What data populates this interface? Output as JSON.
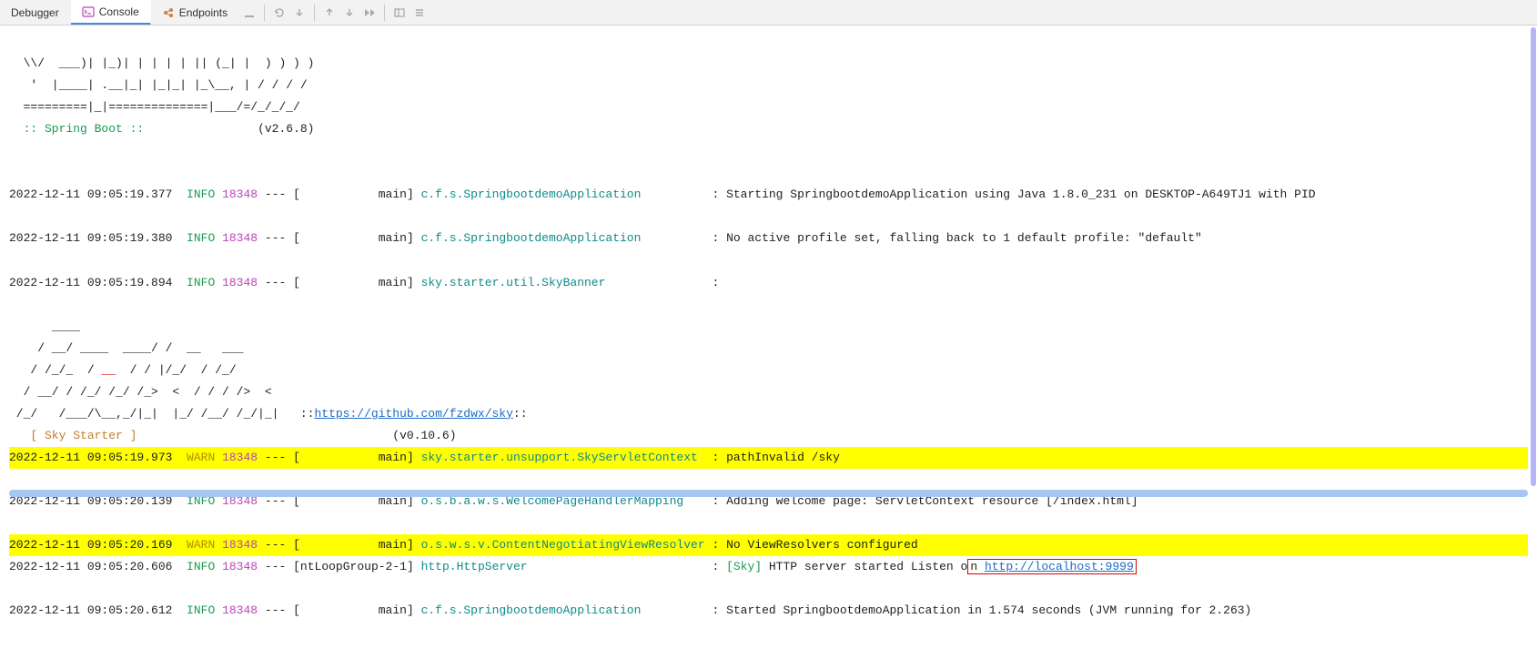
{
  "tabs": {
    "debugger": "Debugger",
    "console": "Console",
    "endpoints": "Endpoints"
  },
  "banner": {
    "line1": "  \\\\/  ___)| |_)| | | | | || (_| |  ) ) ) )",
    "line2": "   '  |____| .__|_| |_|_| |_\\__, | / / / /",
    "line3": "  =========|_|==============|___/=/_/_/_/",
    "label": "  :: Spring Boot ::",
    "version": "(v2.6.8)"
  },
  "logs": [
    {
      "ts": "2022-12-11 09:05:19.377",
      "level": "INFO",
      "pid": "18348",
      "thread": "[           main]",
      "logger": "c.f.s.SpringbootdemoApplication         ",
      "msg": "Starting SpringbootdemoApplication using Java 1.8.0_231 on DESKTOP-A649TJ1 with PID"
    },
    {
      "ts": "2022-12-11 09:05:19.380",
      "level": "INFO",
      "pid": "18348",
      "thread": "[           main]",
      "logger": "c.f.s.SpringbootdemoApplication         ",
      "msg": "No active profile set, falling back to 1 default profile: \"default\""
    },
    {
      "ts": "2022-12-11 09:05:19.894",
      "level": "INFO",
      "pid": "18348",
      "thread": "[           main]",
      "logger": "sky.starter.util.SkyBanner              ",
      "msg": ""
    }
  ],
  "skyBanner": {
    "l1": "      ____",
    "l2": "    / __/ ____  ____/ /  __   ___",
    "l3": "   / /_/_  / __  / / |/_/  / /_/",
    "l4": "  / __/ / /_/ /_/ /_>  <  / / / />  <",
    "l5": " /_/   /___/\\__,_/|_|  |_/ /__/ /_/|_|   ::",
    "link": "https://github.com/fzdwx/sky",
    "linkSuffix": "::",
    "label": "   [ Sky Starter ]",
    "version": "(v0.10.6)"
  },
  "logs2": [
    {
      "ts": "2022-12-11 09:05:19.973",
      "level": "WARN",
      "pid": "18348",
      "thread": "[           main]",
      "logger": "sky.starter.unsupport.SkyServletContext ",
      "msg": "pathInvalid /sky",
      "warn": true
    },
    {
      "ts": "2022-12-11 09:05:20.139",
      "level": "INFO",
      "pid": "18348",
      "thread": "[           main]",
      "logger": "o.s.b.a.w.s.WelcomePageHandlerMapping   ",
      "msg": "Adding welcome page: ServletContext resource [/index.html]"
    },
    {
      "ts": "2022-12-11 09:05:20.169",
      "level": "WARN",
      "pid": "18348",
      "thread": "[           main]",
      "logger": "o.s.w.s.v.ContentNegotiatingViewResolver",
      "msg": "No ViewResolvers configured",
      "warn": true
    }
  ],
  "httpLine": {
    "ts": "2022-12-11 09:05:20.606",
    "level": "INFO",
    "pid": "18348",
    "thread": "[ntLoopGroup-2-1]",
    "logger": "http.HttpServer                         ",
    "prefix": "[Sky]",
    "mid": " HTTP server started Listen o",
    "nChar": "n ",
    "url": "http://localhost:9999"
  },
  "lastLine": {
    "ts": "2022-12-11 09:05:20.612",
    "level": "INFO",
    "pid": "18348",
    "thread": "[           main]",
    "logger": "c.f.s.SpringbootdemoApplication         ",
    "msg": "Started SpringbootdemoApplication in 1.574 seconds (JVM running for 2.263)"
  }
}
